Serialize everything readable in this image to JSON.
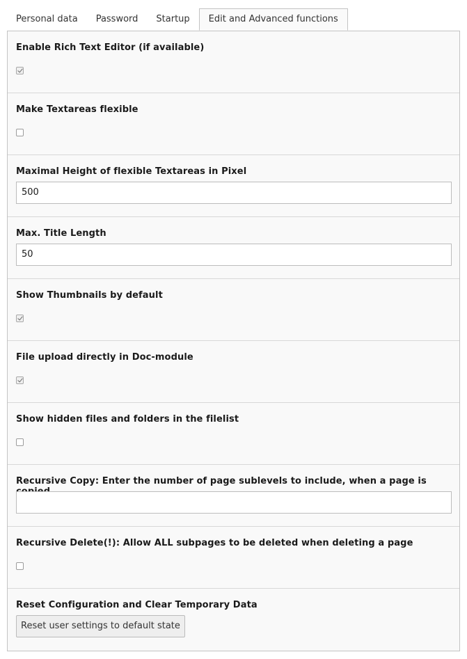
{
  "tabs": [
    {
      "label": "Personal data"
    },
    {
      "label": "Password"
    },
    {
      "label": "Startup"
    },
    {
      "label": "Edit and Advanced functions"
    }
  ],
  "active_tab": "Edit and Advanced functions",
  "fields": {
    "rte": {
      "label": "Enable Rich Text Editor (if available)",
      "checked": true
    },
    "textarea_flex": {
      "label": "Make Textareas flexible",
      "checked": false
    },
    "textarea_max_height": {
      "label": "Maximal Height of flexible Textareas in Pixel",
      "value": "500"
    },
    "title_len": {
      "label": "Max. Title Length",
      "value": "50"
    },
    "thumbnails": {
      "label": "Show Thumbnails by default",
      "checked": true
    },
    "file_upload": {
      "label": "File upload directly in Doc-module",
      "checked": true
    },
    "hidden_files": {
      "label": "Show hidden files and folders in the filelist",
      "checked": false
    },
    "recursive_copy": {
      "label": "Recursive Copy: Enter the number of page sublevels to include, when a page is copied",
      "value": ""
    },
    "recursive_delete": {
      "label": "Recursive Delete(!): Allow ALL subpages to be deleted when deleting a page",
      "checked": false
    },
    "reset": {
      "label": "Reset Configuration and Clear Temporary Data",
      "button": "Reset user settings to default state"
    }
  }
}
